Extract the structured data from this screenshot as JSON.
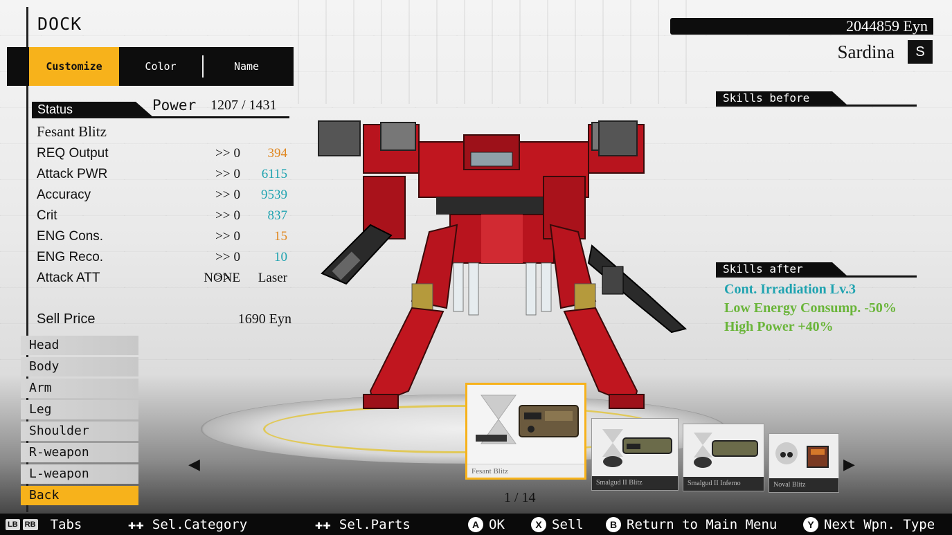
{
  "screen_title": "DOCK",
  "tabs": [
    {
      "label": "Customize",
      "active": true
    },
    {
      "label": "Color",
      "active": false
    },
    {
      "label": "Name",
      "active": false
    }
  ],
  "status": {
    "label": "Status",
    "power_label": "Power",
    "power_value": "1207 / 1431"
  },
  "part_name": "Fesant Blitz",
  "stats": [
    {
      "label": "REQ Output",
      "before": "0",
      "arrow": ">>",
      "after": "394",
      "color": "#e08822"
    },
    {
      "label": "Attack PWR",
      "before": "0",
      "arrow": ">>",
      "after": "6115",
      "color": "#1fa3b0"
    },
    {
      "label": "Accuracy",
      "before": "0",
      "arrow": ">>",
      "after": "9539",
      "color": "#1fa3b0"
    },
    {
      "label": "Crit",
      "before": "0",
      "arrow": ">>",
      "after": "837",
      "color": "#1fa3b0"
    },
    {
      "label": "ENG Cons.",
      "before": "0",
      "arrow": ">>",
      "after": "15",
      "color": "#e08822"
    },
    {
      "label": "ENG Reco.",
      "before": "0",
      "arrow": ">>",
      "after": "10",
      "color": "#1fa3b0"
    },
    {
      "label": "Attack ATT",
      "before": "NONE",
      "arrow": ">>",
      "after": "Laser",
      "color": "#111111"
    }
  ],
  "sell": {
    "label": "Sell Price",
    "value": "1690 Eyn"
  },
  "categories": [
    {
      "label": "Head"
    },
    {
      "label": "Body"
    },
    {
      "label": "Arm"
    },
    {
      "label": "Leg"
    },
    {
      "label": "Shoulder"
    },
    {
      "label": "R-weapon"
    },
    {
      "label": "L-weapon"
    },
    {
      "label": "Back",
      "active": true
    }
  ],
  "currency": "2044859 Eyn",
  "pilot": {
    "name": "Sardina",
    "rank": "S"
  },
  "skills_before": {
    "label": "Skills before",
    "items": []
  },
  "skills_after": {
    "label": "Skills after",
    "items": [
      {
        "text": "Cont. Irradiation Lv.3",
        "color": "#1fa3b0"
      },
      {
        "text": "Low Energy Consump. -50%",
        "color": "#6ab53a"
      },
      {
        "text": "High Power +40%",
        "color": "#6ab53a"
      }
    ]
  },
  "parts_carousel": {
    "items": [
      {
        "name": "Fesant Blitz",
        "selected": true
      },
      {
        "name": "Smalgud II Blitz",
        "selected": false
      },
      {
        "name": "Smalgud II Inferno",
        "selected": false
      },
      {
        "name": "Noval Blitz",
        "selected": false
      }
    ],
    "page": "1 / 14"
  },
  "button_hints": [
    {
      "buttons": [
        "LB",
        "RB"
      ],
      "label": "Tabs"
    },
    {
      "buttons": [
        "dpad-up-down"
      ],
      "label": "Sel.Category"
    },
    {
      "buttons": [
        "dpad-left-right"
      ],
      "label": "Sel.Parts"
    },
    {
      "buttons": [
        "A"
      ],
      "label": "OK"
    },
    {
      "buttons": [
        "X"
      ],
      "label": "Sell"
    },
    {
      "buttons": [
        "B"
      ],
      "label": "Return to Main Menu"
    },
    {
      "buttons": [
        "Y"
      ],
      "label": "Next Wpn. Type"
    }
  ],
  "colors": {
    "accent": "#f7b21b",
    "teal": "#1fa3b0",
    "orange": "#e08822",
    "green": "#6ab53a",
    "mech_red": "#b8141e"
  }
}
